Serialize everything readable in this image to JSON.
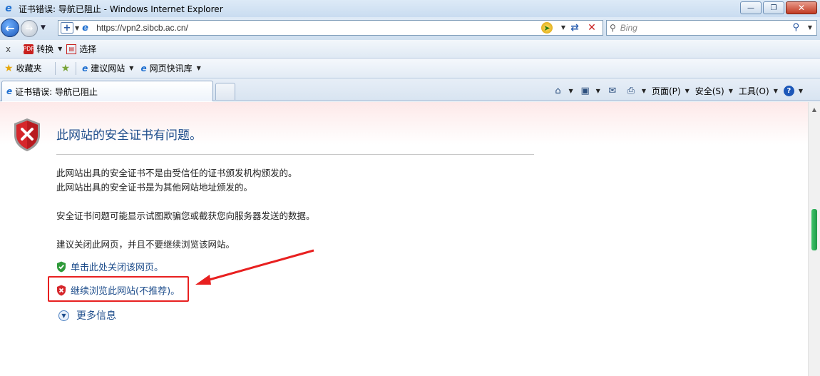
{
  "window": {
    "title": "证书错误: 导航已阻止 - Windows Internet Explorer",
    "minimize": "—",
    "restore": "❐",
    "close": "✕"
  },
  "address": {
    "url": "https://vpn2.sibcb.ac.cn/",
    "search_placeholder": "Bing"
  },
  "convert_bar": {
    "close": "x",
    "convert_label": "转换",
    "select_label": "选择"
  },
  "favorites_bar": {
    "favorites_label": "收藏夹",
    "suggested_sites": "建议网站",
    "web_slice_gallery": "网页快讯库"
  },
  "tab": {
    "label": "证书错误: 导航已阻止"
  },
  "command_bar": {
    "page": "页面(P)",
    "safety": "安全(S)",
    "tools": "工具(O)"
  },
  "content": {
    "heading": "此网站的安全证书有问题。",
    "line1": "此网站出具的安全证书不是由受信任的证书颁发机构颁发的。",
    "line2": "此网站出具的安全证书是为其他网站地址颁发的。",
    "line3": "安全证书问题可能显示试图欺骗您或截获您向服务器发送的数据。",
    "line4": "建议关闭此网页，并且不要继续浏览该网站。",
    "close_link": "单击此处关闭该网页。",
    "continue_link": "继续浏览此网站(不推荐)。",
    "more_info": "更多信息"
  },
  "colors": {
    "link": "#1f4e8c",
    "highlight_box": "#e82020",
    "arrow": "#e82020"
  }
}
